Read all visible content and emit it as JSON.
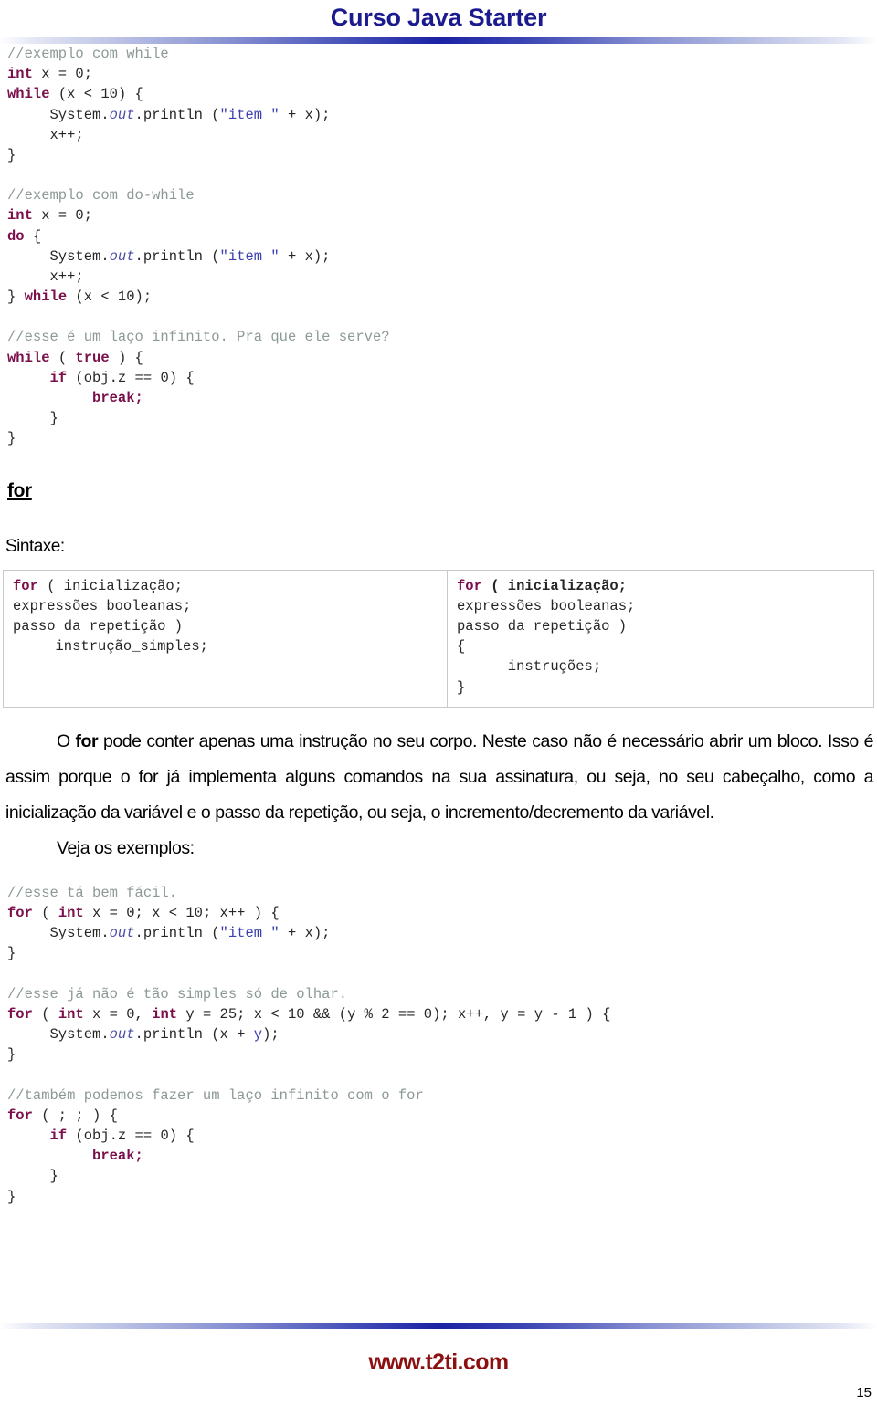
{
  "header": {
    "title": "Curso Java Starter",
    "accent_color": "#1b1b8f"
  },
  "code_blocks": {
    "while_example": {
      "comment": "//exemplo com while",
      "lines": [
        "int x = 0;",
        "while (x < 10) {",
        "    System.out.println (\"item \" + x);",
        "    x++;",
        "}"
      ]
    },
    "dowhile_example": {
      "comment": "//exemplo com do-while",
      "lines": [
        "int x = 0;",
        "do {",
        "    System.out.println (\"item \" + x);",
        "    x++;",
        "} while (x < 10);"
      ]
    },
    "infinite_while_example": {
      "comment": "//esse é um laço infinito. Pra que ele serve?",
      "lines": [
        "while ( true ) {",
        "    if (obj.z == 0) {",
        "        break;",
        "    }",
        "}"
      ]
    },
    "for_simple_example": {
      "comment": "//esse tá bem fácil.",
      "lines": [
        "for ( int x = 0; x < 10; x++ ) {",
        "    System.out.println (\"item \" + x);",
        "}"
      ]
    },
    "for_complex_example": {
      "comment": "//esse já não é tão simples só de olhar.",
      "lines": [
        "for ( int x = 0, int y = 25; x < 10 && (y % 2 == 0); x++, y = y - 1 ) {",
        "    System.out.println (x + y);",
        "}"
      ]
    },
    "for_infinite_example": {
      "comment": "//também podemos fazer um laço infinito com o for",
      "lines": [
        "for ( ; ; ) {",
        "    if (obj.z == 0) {",
        "        break;",
        "    }",
        "}"
      ]
    }
  },
  "section": {
    "heading": "for",
    "syntax_label": "Sintaxe:"
  },
  "syntax_table": {
    "left": {
      "line1_kw": "for",
      "line1_rest": " ( inicialização;",
      "line2": "expressões booleanas;",
      "line3": "passo da repetição )",
      "line4": "     instrução_simples;"
    },
    "right": {
      "line1_kw": "for",
      "line1_rest": " ( inicialização;",
      "line2": "expressões booleanas;",
      "line3": "passo da repetição )",
      "line4": "{",
      "line5": "      instruções;",
      "line6": "}"
    }
  },
  "paragraph": {
    "part1": "O ",
    "bold_for": "for",
    "part2": " pode conter apenas uma instrução no seu corpo. Neste caso não é necessário abrir um bloco. Isso é assim porque o for já implementa alguns comandos na sua assinatura, ou seja, no seu cabeçalho, como a inicialização da variável e o passo da repetição, ou seja, o incremento/decremento da variável.",
    "follow": "Veja os exemplos:"
  },
  "footer": {
    "url": "www.t2ti.com",
    "page_number": "15",
    "url_color": "#8c1010"
  }
}
